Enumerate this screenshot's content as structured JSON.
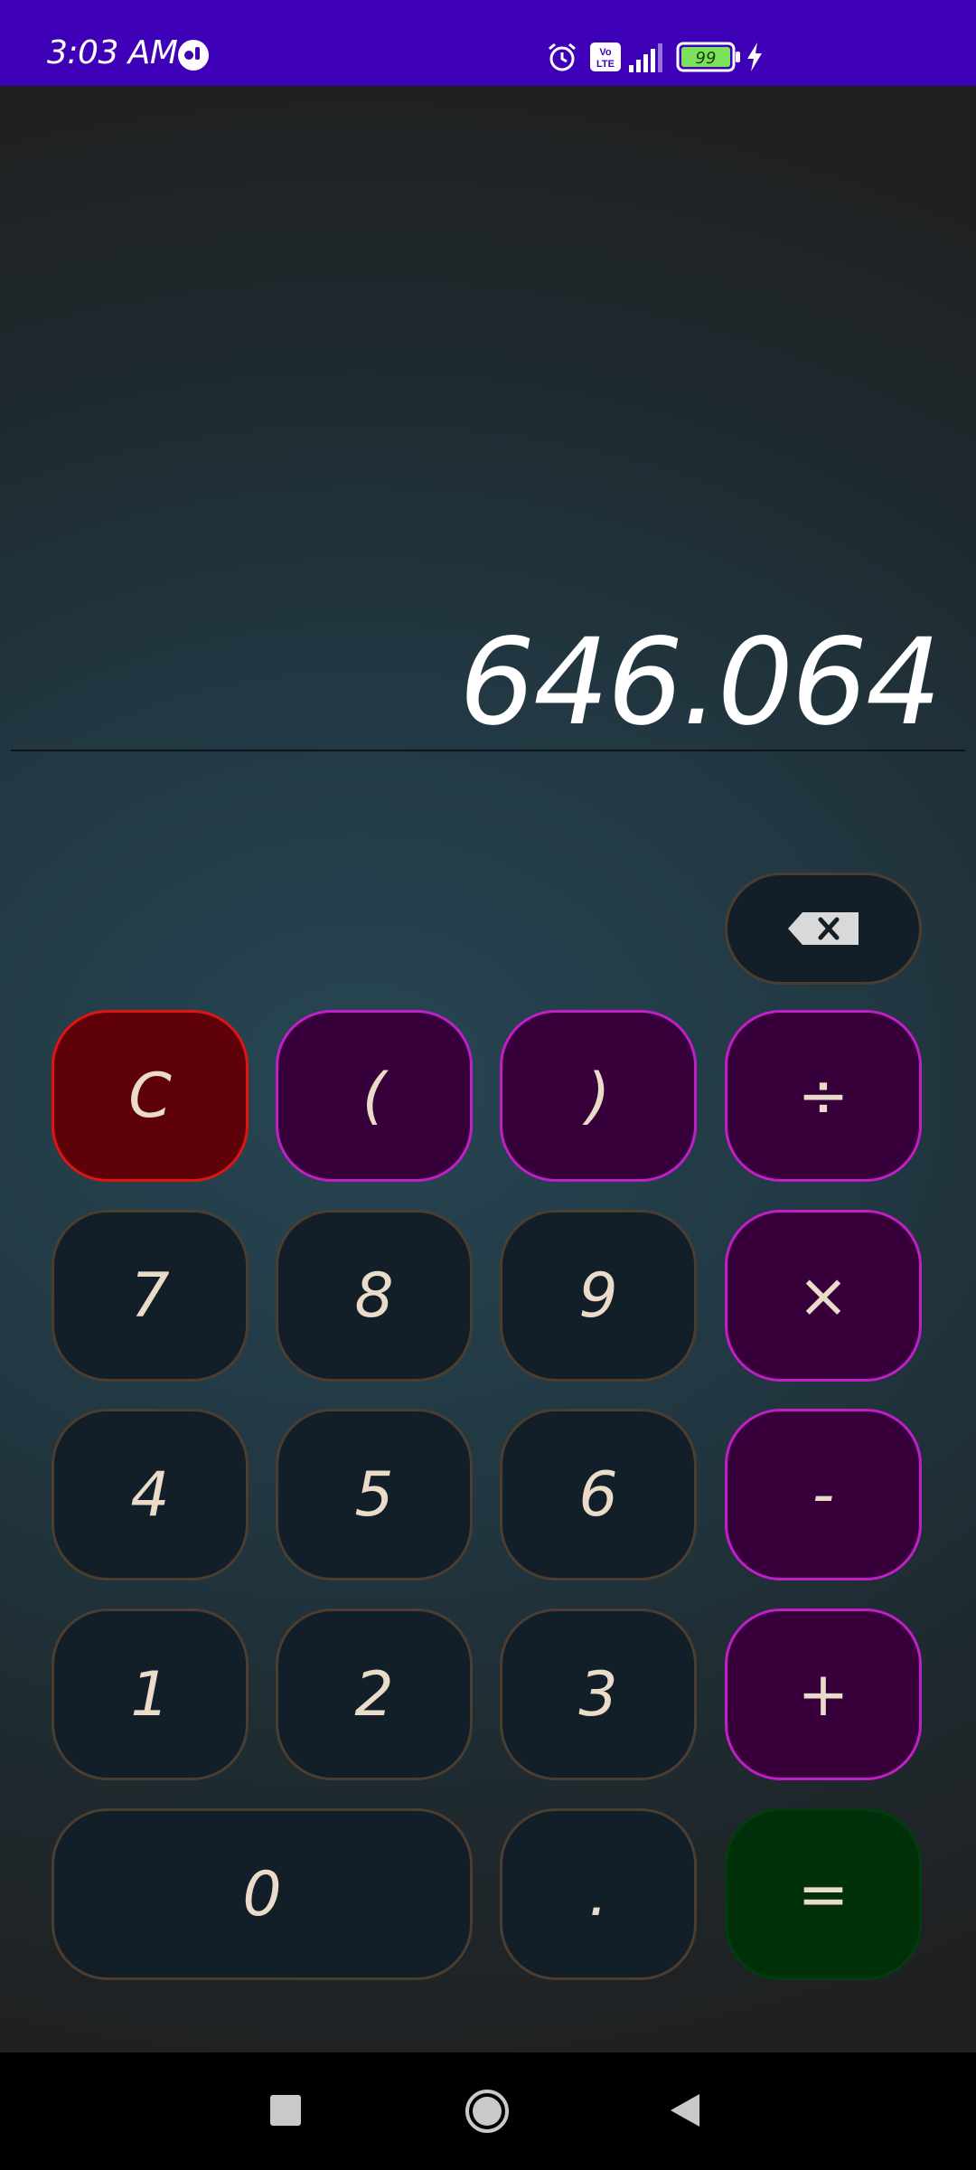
{
  "status_bar": {
    "time": "3:03 AM",
    "battery": "99",
    "network_label": "Vo LTE",
    "icons": [
      "notification-icon",
      "alarm-icon",
      "volte-icon",
      "signal-icon",
      "battery-icon",
      "charging-icon"
    ]
  },
  "display": {
    "result": "646.064"
  },
  "keypad": {
    "clear": "C",
    "paren_open": "(",
    "paren_close": ")",
    "divide": "÷",
    "seven": "7",
    "eight": "8",
    "nine": "9",
    "multiply": "×",
    "four": "4",
    "five": "5",
    "six": "6",
    "minus": "-",
    "one": "1",
    "two": "2",
    "three": "3",
    "plus": "+",
    "zero": "0",
    "decimal": ".",
    "equals": "="
  },
  "colors": {
    "status_bar": "#3e01b8",
    "number_key": "#131f28",
    "operator_key": "#37003a",
    "operator_border": "#c21ec8",
    "clear_key": "#5e0109",
    "clear_border": "#e11414",
    "equals_key": "#00300a",
    "key_text": "#eadcc9"
  },
  "nav_bar": {
    "icons": [
      "recents-icon",
      "home-icon",
      "back-icon"
    ]
  }
}
